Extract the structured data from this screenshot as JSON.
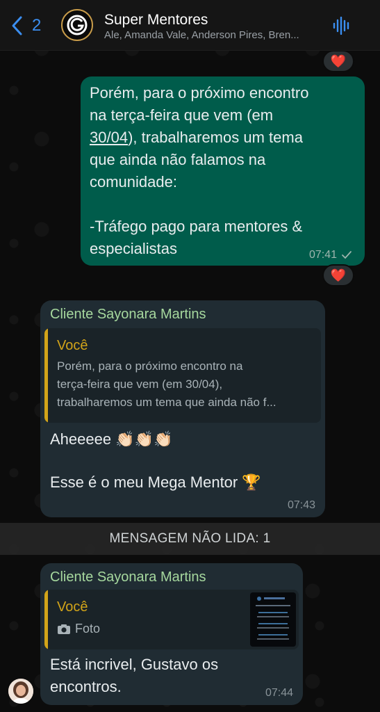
{
  "header": {
    "back_count": "2",
    "title": "Super Mentores",
    "members": "Ale, Amanda Vale, Anderson Pires, Bren..."
  },
  "messages": {
    "outgoing": {
      "text_parts": [
        "Porém, para o próximo encontro\nna terça-feira que vem (em\n",
        "30/04",
        "), trabalharemos um tema\nque ainda não falamos na\ncomunidade:\n\n-Tráfego pago para mentores &\nespecialistas"
      ],
      "time": "07:41",
      "reaction": "❤️"
    },
    "top_reaction": "❤️",
    "reply1": {
      "sender": "Cliente Sayonara Martins",
      "quote_author": "Você",
      "quote_text": "Porém, para o próximo encontro na\nterça-feira que vem (em 30/04),\ntrabalharemos um tema que ainda não f...",
      "line1": "Aheeeee 👏🏻👏🏻👏🏻",
      "line2": "Esse é o meu Mega Mentor 🏆",
      "time": "07:43"
    },
    "unread_divider": "MENSAGEM NÃO LIDA: 1",
    "reply2": {
      "sender": "Cliente Sayonara Martins",
      "quote_author": "Você",
      "quote_media": "Foto",
      "text": "Está incrivel, Gustavo os\nencontros.",
      "time": "07:44"
    }
  },
  "colors": {
    "outgoing_bubble": "#005c4b",
    "incoming_bubble": "#202c33",
    "sender_name": "#a6d89e",
    "quote_accent": "#d2a419",
    "back_blue": "#3b8ef0"
  }
}
